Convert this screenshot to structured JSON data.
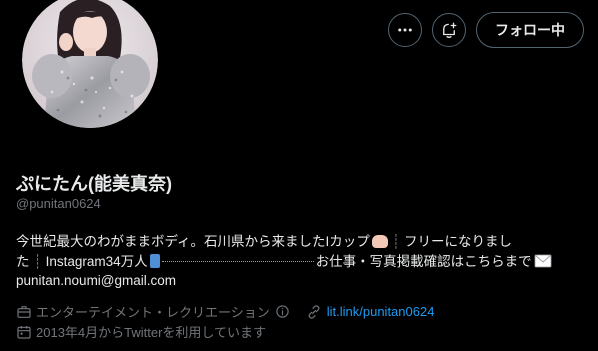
{
  "profile": {
    "display_name": "ぷにたん(能美真奈)",
    "handle": "@punitan0624",
    "follow_button": "フォロー中",
    "bio_line1": "今世紀最大のわがままボディ。石川県から来ましたIカップ",
    "bio_line1_tail": "フリーになりまし",
    "bio_line2_head": "た",
    "bio_line2_instagram": "Instagram34万人",
    "bio_line2_tail": "お仕事・写真掲載確認はこちらまで",
    "bio_line3": "punitan.noumi@gmail.com",
    "category": "エンターテイメント・レクリエーション",
    "website": "lit.link/punitan0624",
    "joined": "2013年4月からTwitterを利用しています"
  },
  "icons": {
    "more": "more-icon",
    "notify": "bell-plus-icon",
    "category": "briefcase-icon",
    "info": "info-icon",
    "link": "link-icon",
    "calendar": "calendar-icon"
  },
  "colors": {
    "background": "#000000",
    "text": "#e7e9ea",
    "secondary": "#71767b",
    "link": "#1d9bf0",
    "border": "#536471"
  }
}
